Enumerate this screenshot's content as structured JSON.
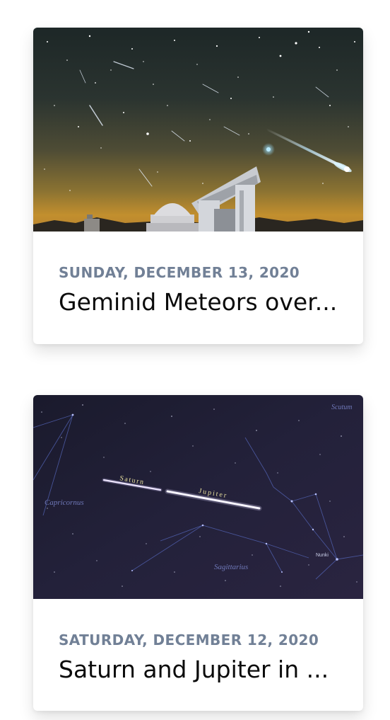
{
  "posts": [
    {
      "date": "SUNDAY, DECEMBER 13, 2020",
      "title": "Geminid Meteors over...",
      "image_icon": "meteor-shower-observatory-photo"
    },
    {
      "date": "SATURDAY, DECEMBER 12, 2020",
      "title": "Saturn and Jupiter in ...",
      "image_icon": "saturn-jupiter-star-chart-photo",
      "image_labels": {
        "saturn": "Saturn",
        "jupiter": "Jupiter",
        "capricornus": "Capricornus",
        "sagittarius": "Sagittarius",
        "scutum": "Scutum",
        "nunki": "Nunki"
      }
    }
  ],
  "colors": {
    "date_text": "#718096",
    "title_text": "#0b0b0b",
    "card_background": "#ffffff"
  }
}
